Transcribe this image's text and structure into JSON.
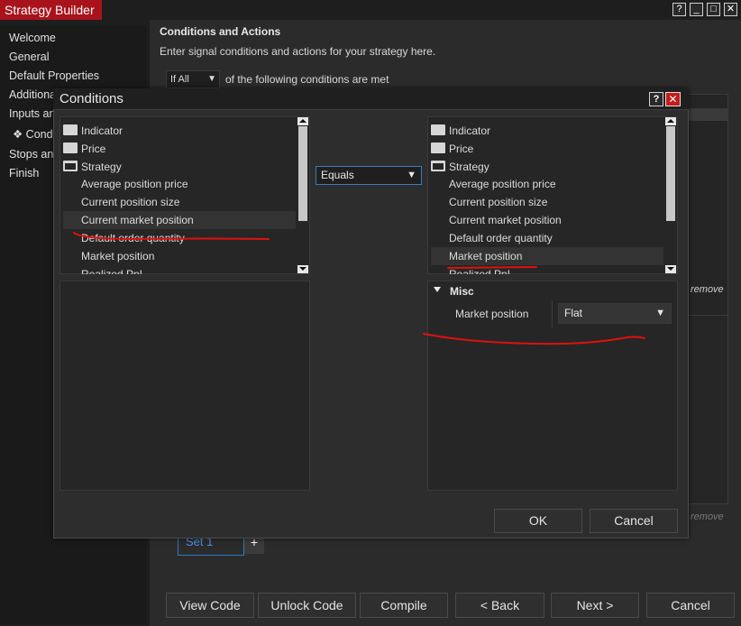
{
  "window": {
    "title": "Strategy Builder",
    "controls": [
      "?",
      "_",
      "□",
      "✕"
    ]
  },
  "sidebar": {
    "items": [
      "Welcome",
      "General",
      "Default Properties",
      "Additiona",
      "Inputs an",
      "❖ Condi",
      "Stops an",
      "Finish"
    ]
  },
  "main": {
    "title": "Conditions and Actions",
    "description": "Enter signal conditions and actions for your strategy here.",
    "condition_mode": "If All",
    "condition_text": "of the following conditions are met",
    "remove_top": "remove",
    "remove_bottom": "remove",
    "set_tab": "Set 1",
    "add_set": "+"
  },
  "footer": {
    "view_code": "View Code",
    "unlock_code": "Unlock Code",
    "compile": "Compile",
    "back": "< Back",
    "next": "Next >",
    "cancel": "Cancel"
  },
  "dialog": {
    "title": "Conditions",
    "help": "?",
    "close": "✕",
    "left_tree": {
      "folders": [
        "Indicator",
        "Price",
        "Strategy"
      ],
      "items": [
        "Average position price",
        "Current position size",
        "Current market position",
        "Default order quantity",
        "Market position",
        "Realized PnL"
      ],
      "selected": "Current market position"
    },
    "operator": "Equals",
    "right_tree": {
      "folders": [
        "Indicator",
        "Price",
        "Strategy"
      ],
      "items": [
        "Average position price",
        "Current position size",
        "Current market position",
        "Default order quantity",
        "Market position",
        "Realized PnL"
      ],
      "selected": "Market position"
    },
    "properties": {
      "group": "Misc",
      "label": "Market position",
      "value": "Flat"
    },
    "ok": "OK",
    "cancel": "Cancel"
  },
  "colors": {
    "accent_red": "#a8131b",
    "annotation_red": "#e01010",
    "focus_blue": "#3d7bc0"
  },
  "icons": {
    "folder": "folder-icon",
    "folder_open": "folder-open-icon",
    "dropdown": "chevron-down-icon",
    "collapse": "collapse-triangle-icon"
  }
}
